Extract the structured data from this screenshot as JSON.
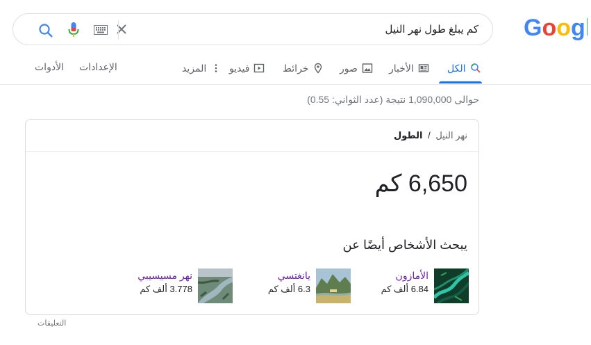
{
  "logo": {
    "text": "Google",
    "colors": [
      "#4285F4",
      "#EA4335",
      "#FBBC05",
      "#4285F4",
      "#34A853",
      "#EA4335"
    ]
  },
  "search": {
    "query": "كم يبلغ طول نهر النيل"
  },
  "tabs": [
    {
      "label": "الكل",
      "icon": "search-icon",
      "active": true
    },
    {
      "label": "الأخبار",
      "icon": "news-icon"
    },
    {
      "label": "صور",
      "icon": "image-icon"
    },
    {
      "label": "خرائط",
      "icon": "map-pin-icon"
    },
    {
      "label": "فيديو",
      "icon": "video-icon"
    },
    {
      "label": "المزيد",
      "icon": "more-vert-icon"
    }
  ],
  "tools": {
    "settings": "الإعدادات",
    "tools": "الأدوات"
  },
  "stats": "حوالى 1,090,000 نتيجة (عدد الثواني: 0.55)",
  "card": {
    "breadcrumb_parent": "نهر النيل",
    "breadcrumb_sep": "/",
    "breadcrumb_current": "الطول",
    "answer": "6,650 كم",
    "pasa_title": "يبحث الأشخاص أيضًا عن",
    "entities": [
      {
        "name": "الأمازون",
        "value": "6.84 ألف كم"
      },
      {
        "name": "يانغتسي",
        "value": "6.3 ألف كم"
      },
      {
        "name": "نهر مسيسيبي",
        "value": "3.778 ألف كم"
      }
    ]
  },
  "feedback": "التعليقات",
  "colors": {
    "accent": "#1a73e8",
    "visited": "#681da8"
  }
}
